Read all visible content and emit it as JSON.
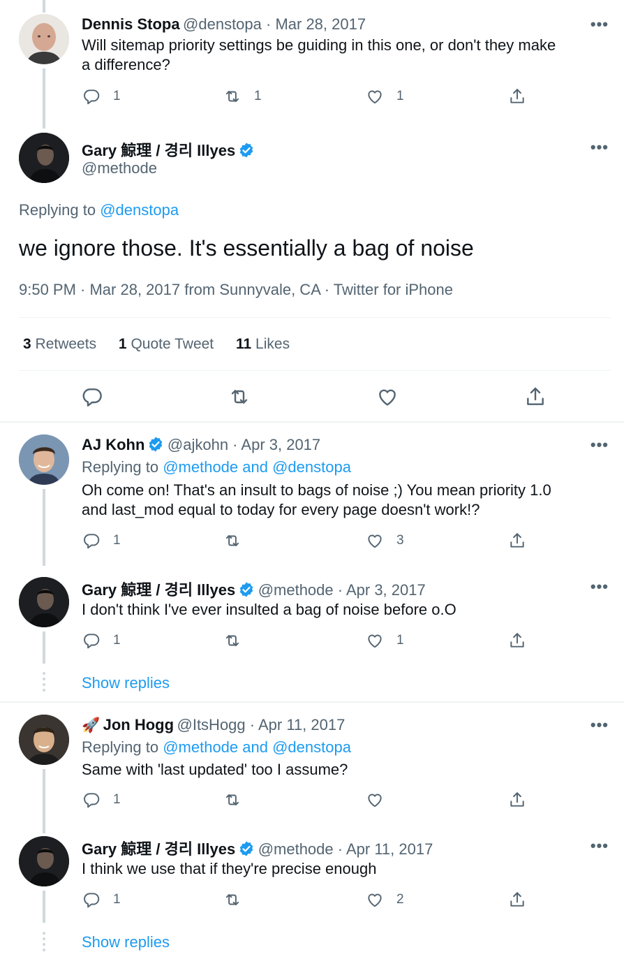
{
  "tweet1": {
    "name": "Dennis Stopa",
    "meta": "@denstopa · Mar 28, 2017",
    "text": "Will sitemap priority settings be guiding in this one, or don't they make\na difference?",
    "replies": "1",
    "retweets": "1",
    "likes": "1"
  },
  "main": {
    "name": "Gary 鯨理 / 경리 Illyes",
    "handle": "@methode",
    "replying_label": "Replying to",
    "replying_to": "@denstopa",
    "text": "we ignore those. It's essentially a bag of noise",
    "timestamp": "9:50 PM · Mar 28, 2017 from Sunnyvale, CA · Twitter for iPhone",
    "retweets_count": "3",
    "retweets_label": "Retweets",
    "quotes_count": "1",
    "quotes_label": "Quote Tweet",
    "likes_count": "11",
    "likes_label": "Likes"
  },
  "tweet3": {
    "name": "AJ Kohn",
    "meta": "@ajkohn · Apr 3, 2017",
    "replying_label": "Replying to",
    "replying_to": "@methode and @denstopa",
    "text": "Oh come on! That's an insult to bags of noise ;) You mean priority 1.0\nand last_mod equal to today for every page doesn't work!?",
    "replies": "1",
    "retweets": "",
    "likes": "3"
  },
  "tweet4": {
    "name": "Gary 鯨理 / 경리 Illyes",
    "meta": "@methode · Apr 3, 2017",
    "text": "I don't think I've ever insulted a bag of noise before o.O",
    "replies": "1",
    "retweets": "",
    "likes": "1",
    "show_replies": "Show replies"
  },
  "tweet5": {
    "emoji": "🚀",
    "name": "Jon Hogg",
    "meta": "@ItsHogg · Apr 11, 2017",
    "replying_label": "Replying to",
    "replying_to": "@methode and @denstopa",
    "text": "Same with 'last updated' too I assume?",
    "replies": "1",
    "retweets": "",
    "likes": ""
  },
  "tweet6": {
    "name": "Gary 鯨理 / 경리 Illyes",
    "meta": "@methode · Apr 11, 2017",
    "text": "I think we use that if they're precise enough",
    "replies": "1",
    "retweets": "",
    "likes": "2",
    "show_replies": "Show replies"
  },
  "more_label": "•••",
  "colors": {
    "accent": "#1d9bf0",
    "secondary": "#536471",
    "thread": "#cfd9de"
  }
}
